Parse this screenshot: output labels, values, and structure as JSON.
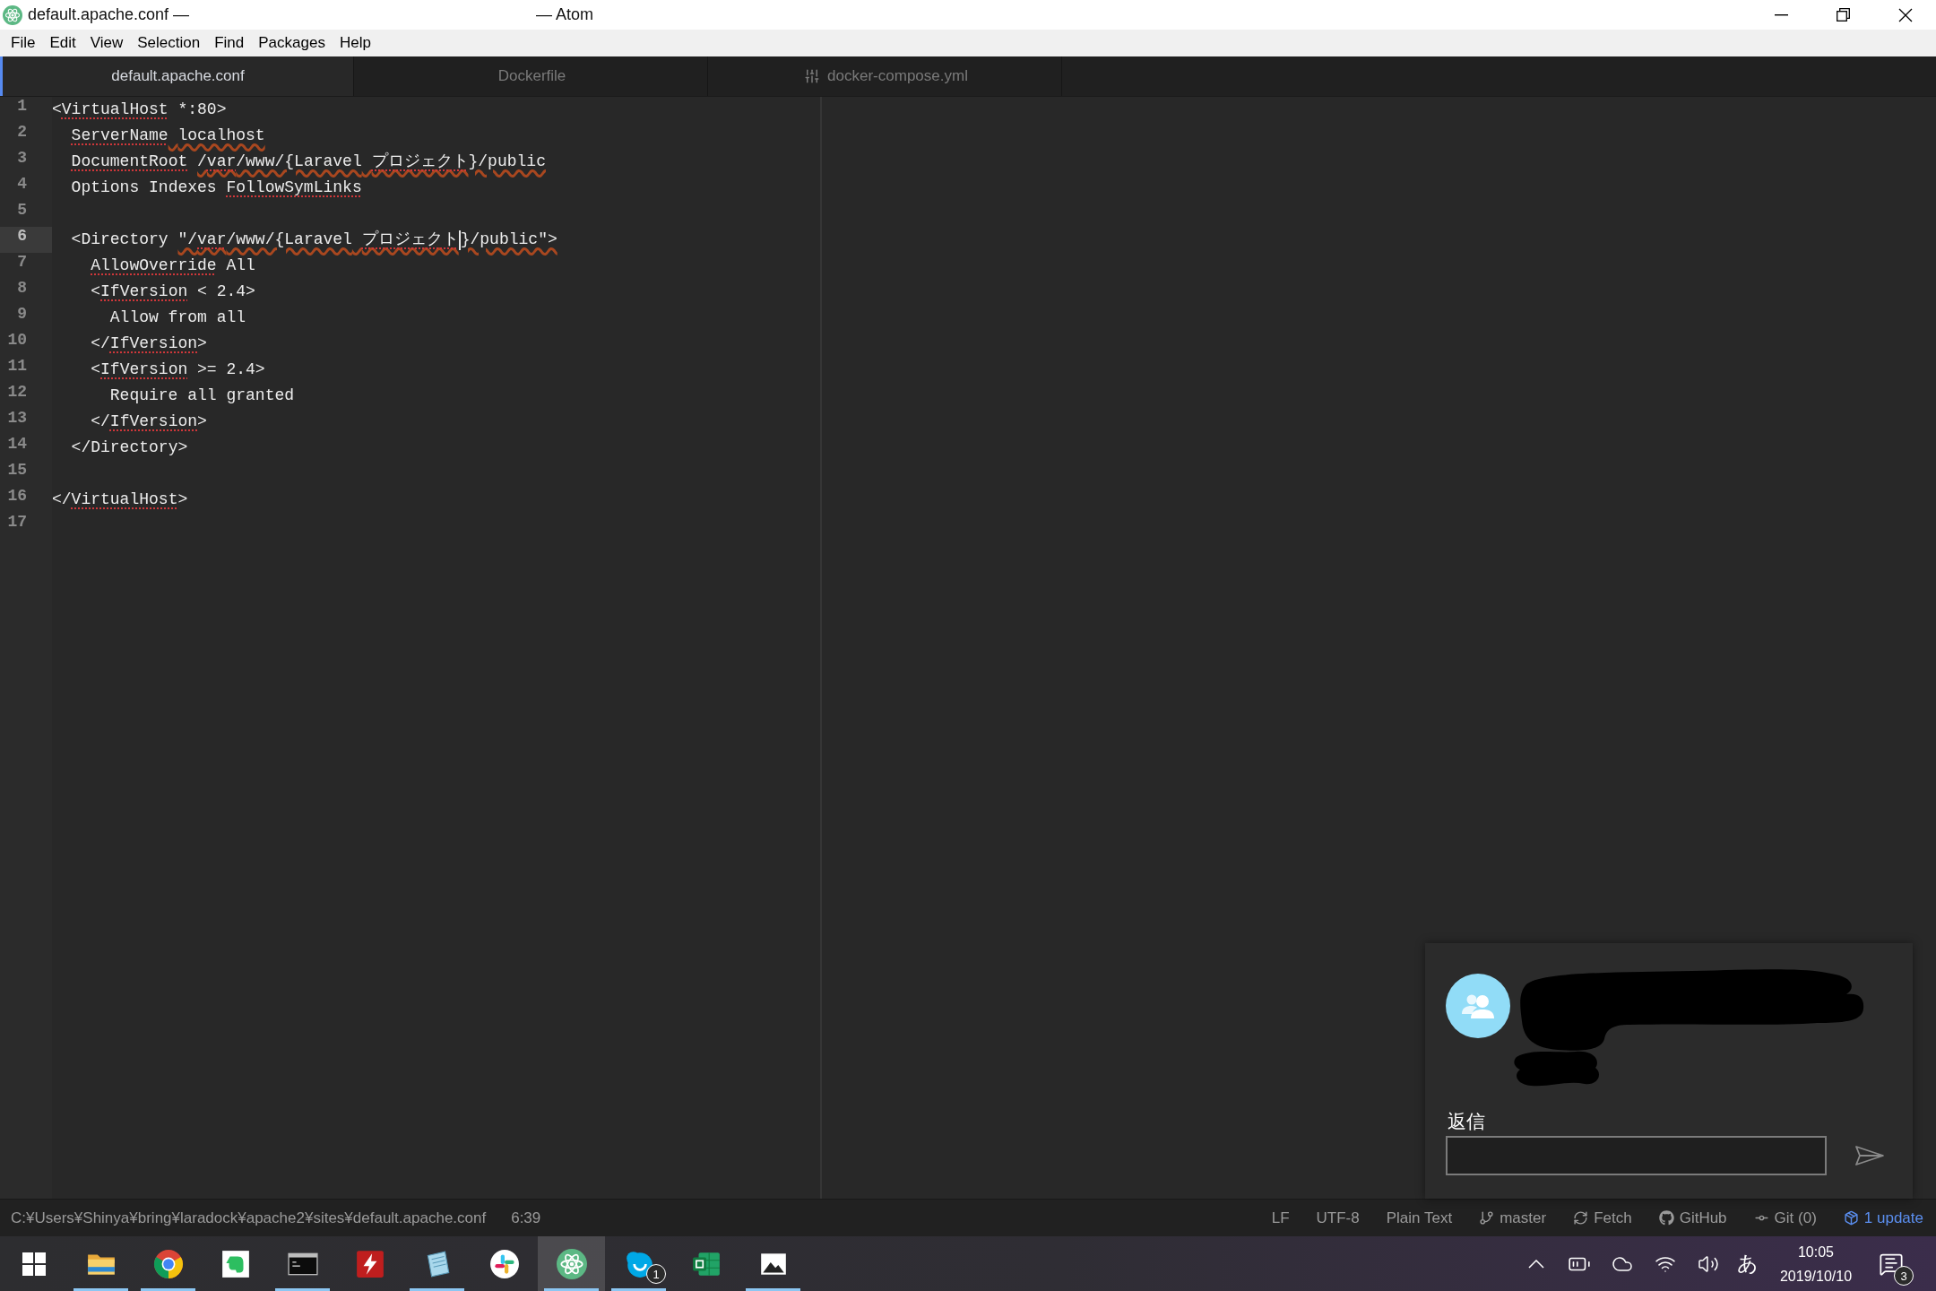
{
  "window": {
    "title": "default.apache.conf —",
    "app_title": "— Atom"
  },
  "menu": [
    "File",
    "Edit",
    "View",
    "Selection",
    "Find",
    "Packages",
    "Help"
  ],
  "tabs": [
    {
      "title": "default.apache.conf",
      "selected": true,
      "kind": "plain"
    },
    {
      "title": "Dockerfile",
      "selected": false,
      "kind": "plain"
    },
    {
      "title": "docker-compose.yml",
      "selected": false,
      "kind": "config"
    }
  ],
  "editor": {
    "lines": [
      {
        "number": "1",
        "cursor": false,
        "segments": [
          {
            "kind": "text",
            "text": "<",
            "spelling_error": false,
            "hand_underline": false
          },
          {
            "kind": "text",
            "text": "VirtualHost",
            "spelling_error": true,
            "hand_underline": false
          },
          {
            "kind": "text",
            "text": " *:80>",
            "spelling_error": false,
            "hand_underline": false
          }
        ]
      },
      {
        "number": "2",
        "cursor": false,
        "segments": [
          {
            "kind": "text",
            "text": "  ServerName",
            "spelling_error": true,
            "hand_underline": false
          },
          {
            "kind": "text",
            "text": " localhost",
            "spelling_error": false,
            "hand_underline": true
          }
        ]
      },
      {
        "number": "3",
        "cursor": false,
        "segments": [
          {
            "kind": "text",
            "text": "  DocumentRoot ",
            "spelling_error": true,
            "hand_underline": false
          },
          {
            "kind": "text",
            "text": "/",
            "spelling_error": false,
            "hand_underline": true
          },
          {
            "kind": "text",
            "text": "var",
            "spelling_error": true,
            "hand_underline": true
          },
          {
            "kind": "text",
            "text": "/www/{Laravel ",
            "spelling_error": false,
            "hand_underline": true
          },
          {
            "kind": "text",
            "text": "プロジェクト",
            "spelling_error": true,
            "hand_underline": true
          },
          {
            "kind": "text",
            "text": "}/public",
            "spelling_error": false,
            "hand_underline": true
          }
        ]
      },
      {
        "number": "4",
        "cursor": false,
        "segments": [
          {
            "kind": "text",
            "text": "  Options Indexes ",
            "spelling_error": false,
            "hand_underline": false
          },
          {
            "kind": "text",
            "text": "FollowSymLinks",
            "spelling_error": true,
            "hand_underline": false
          }
        ]
      },
      {
        "number": "5",
        "cursor": false
      },
      {
        "number": "6",
        "cursor": true,
        "segments": [
          {
            "kind": "text",
            "text": "  <Directory ",
            "spelling_error": false,
            "hand_underline": false
          },
          {
            "kind": "text",
            "text": "\"/",
            "spelling_error": false,
            "hand_underline": true
          },
          {
            "kind": "text",
            "text": "var",
            "spelling_error": true,
            "hand_underline": true
          },
          {
            "kind": "text",
            "text": "/www/{Laravel ",
            "spelling_error": false,
            "hand_underline": true
          },
          {
            "kind": "text",
            "text": "プロジェクト",
            "spelling_error": true,
            "hand_underline": true
          },
          {
            "kind": "caret"
          },
          {
            "kind": "text",
            "text": "}/public\">",
            "spelling_error": false,
            "hand_underline": true
          }
        ]
      },
      {
        "number": "7",
        "cursor": false,
        "segments": [
          {
            "kind": "text",
            "text": "    AllowOverride",
            "spelling_error": true,
            "hand_underline": false
          },
          {
            "kind": "text",
            "text": " All",
            "spelling_error": false,
            "hand_underline": false
          }
        ]
      },
      {
        "number": "8",
        "cursor": false,
        "segments": [
          {
            "kind": "text",
            "text": "    <",
            "spelling_error": false,
            "hand_underline": false
          },
          {
            "kind": "text",
            "text": "IfVersion",
            "spelling_error": true,
            "hand_underline": false
          },
          {
            "kind": "text",
            "text": " < 2.4>",
            "spelling_error": false,
            "hand_underline": false
          }
        ]
      },
      {
        "number": "9",
        "cursor": false,
        "segments": [
          {
            "kind": "text",
            "text": "      Allow from all",
            "spelling_error": false,
            "hand_underline": false
          }
        ]
      },
      {
        "number": "10",
        "cursor": false,
        "segments": [
          {
            "kind": "text",
            "text": "    </",
            "spelling_error": false,
            "hand_underline": false
          },
          {
            "kind": "text",
            "text": "IfVersion",
            "spelling_error": true,
            "hand_underline": false
          },
          {
            "kind": "text",
            "text": ">",
            "spelling_error": false,
            "hand_underline": false
          }
        ]
      },
      {
        "number": "11",
        "cursor": false,
        "segments": [
          {
            "kind": "text",
            "text": "    <",
            "spelling_error": false,
            "hand_underline": false
          },
          {
            "kind": "text",
            "text": "IfVersion",
            "spelling_error": true,
            "hand_underline": false
          },
          {
            "kind": "text",
            "text": " >= 2.4>",
            "spelling_error": false,
            "hand_underline": false
          }
        ]
      },
      {
        "number": "12",
        "cursor": false,
        "segments": [
          {
            "kind": "text",
            "text": "      Require all granted",
            "spelling_error": false,
            "hand_underline": false
          }
        ]
      },
      {
        "number": "13",
        "cursor": false,
        "segments": [
          {
            "kind": "text",
            "text": "    </",
            "spelling_error": false,
            "hand_underline": false
          },
          {
            "kind": "text",
            "text": "IfVersion",
            "spelling_error": true,
            "hand_underline": false
          },
          {
            "kind": "text",
            "text": ">",
            "spelling_error": false,
            "hand_underline": false
          }
        ]
      },
      {
        "number": "14",
        "cursor": false,
        "segments": [
          {
            "kind": "text",
            "text": "  </Directory>",
            "spelling_error": false,
            "hand_underline": false
          }
        ]
      },
      {
        "number": "15",
        "cursor": false
      },
      {
        "number": "16",
        "cursor": false,
        "segments": [
          {
            "kind": "text",
            "text": "</",
            "spelling_error": false,
            "hand_underline": false
          },
          {
            "kind": "text",
            "text": "VirtualHost",
            "spelling_error": true,
            "hand_underline": false
          },
          {
            "kind": "text",
            "text": ">",
            "spelling_error": false,
            "hand_underline": false
          }
        ]
      },
      {
        "number": "17",
        "cursor": false
      }
    ]
  },
  "notification_popup": {
    "reply_label": "返信"
  },
  "status_bar": {
    "file_path": "C:¥Users¥Shinya¥bring¥laradock¥apache2¥sites¥default.apache.conf",
    "cursor_position": "6:39",
    "items": [
      {
        "kind": "text",
        "text": "LF"
      },
      {
        "kind": "text",
        "text": "UTF-8"
      },
      {
        "kind": "text",
        "text": "Plain Text"
      },
      {
        "kind": "branch",
        "text": "master"
      },
      {
        "kind": "fetch",
        "text": "Fetch"
      },
      {
        "kind": "github",
        "text": "GitHub"
      },
      {
        "kind": "git",
        "text": "Git (0)"
      },
      {
        "kind": "update",
        "text": "1 update"
      }
    ]
  },
  "taskbar": {
    "apps": [
      {
        "kind": "folder",
        "running": true,
        "active": false
      },
      {
        "kind": "browser",
        "running": true,
        "active": false
      },
      {
        "kind": "notes",
        "running": false,
        "active": false
      },
      {
        "kind": "terminal",
        "running": true,
        "active": false
      },
      {
        "kind": "ftp",
        "running": false,
        "active": false
      },
      {
        "kind": "notepad",
        "running": true,
        "active": false
      },
      {
        "kind": "chat",
        "running": false,
        "active": false
      },
      {
        "kind": "editor",
        "running": true,
        "active": true
      },
      {
        "kind": "messenger",
        "running": true,
        "active": false,
        "badge": "1"
      },
      {
        "kind": "spreadsheet",
        "running": false,
        "active": false
      },
      {
        "kind": "photos",
        "running": true,
        "active": false
      }
    ],
    "ime_mode": "あ",
    "clock": {
      "time": "10:05",
      "date": "2019/10/10"
    },
    "notification_count": "3"
  }
}
